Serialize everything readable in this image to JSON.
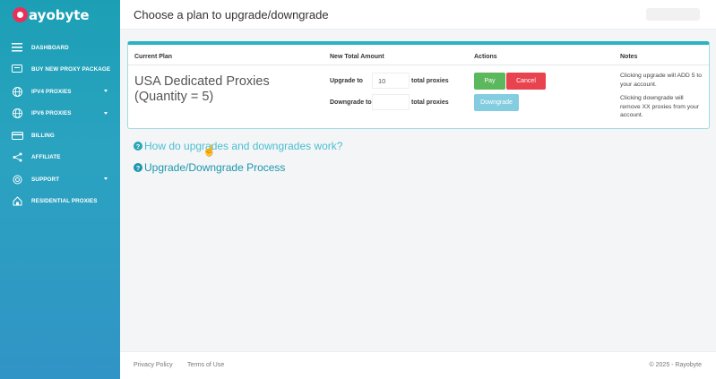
{
  "brand": {
    "name": "ayobyte"
  },
  "header": {
    "title": "Choose a plan to upgrade/downgrade"
  },
  "sidebar": {
    "items": [
      {
        "label": "DASHBOARD",
        "icon": "list-icon",
        "has_caret": false
      },
      {
        "label": "BUY NEW PROXY PACKAGE",
        "icon": "cart-icon",
        "has_caret": false
      },
      {
        "label": "IPV4 PROXIES",
        "icon": "globe-icon",
        "has_caret": true
      },
      {
        "label": "IPV6 PROXIES",
        "icon": "globe-icon",
        "has_caret": true
      },
      {
        "label": "BILLING",
        "icon": "card-icon",
        "has_caret": false
      },
      {
        "label": "AFFILIATE",
        "icon": "share-icon",
        "has_caret": false
      },
      {
        "label": "SUPPORT",
        "icon": "gear-icon",
        "has_caret": true
      },
      {
        "label": "RESIDENTIAL PROXIES",
        "icon": "home-icon",
        "has_caret": false
      }
    ]
  },
  "plan_table": {
    "headers": {
      "current_plan": "Current Plan",
      "new_total": "New Total Amount",
      "actions": "Actions",
      "notes": "Notes"
    },
    "plan_name": "USA Dedicated Proxies (Quantity = 5)",
    "upgrade": {
      "label": "Upgrade to",
      "value": "10",
      "unit": "total proxies",
      "note": "Clicking upgrade will ADD 5 to your account."
    },
    "downgrade": {
      "label": "Downgrade to",
      "value": "",
      "unit": "total proxies",
      "note": "Clicking downgrade will remove XX proxies from your account."
    },
    "buttons": {
      "pay": "Pay",
      "cancel": "Cancel",
      "downgrade": "Downgrade"
    }
  },
  "help": {
    "how_it_works": "How do upgrades and downgrades work?",
    "process": "Upgrade/Downgrade Process"
  },
  "footer": {
    "privacy": "Privacy Policy",
    "terms": "Terms of Use",
    "copyright": "© 2025 - Rayobyte"
  },
  "colors": {
    "accent": "#2bb3c4",
    "pay": "#5cb85c",
    "cancel": "#e8434f",
    "downgrade": "#84cde0",
    "brand_mark": "#e8315a"
  }
}
